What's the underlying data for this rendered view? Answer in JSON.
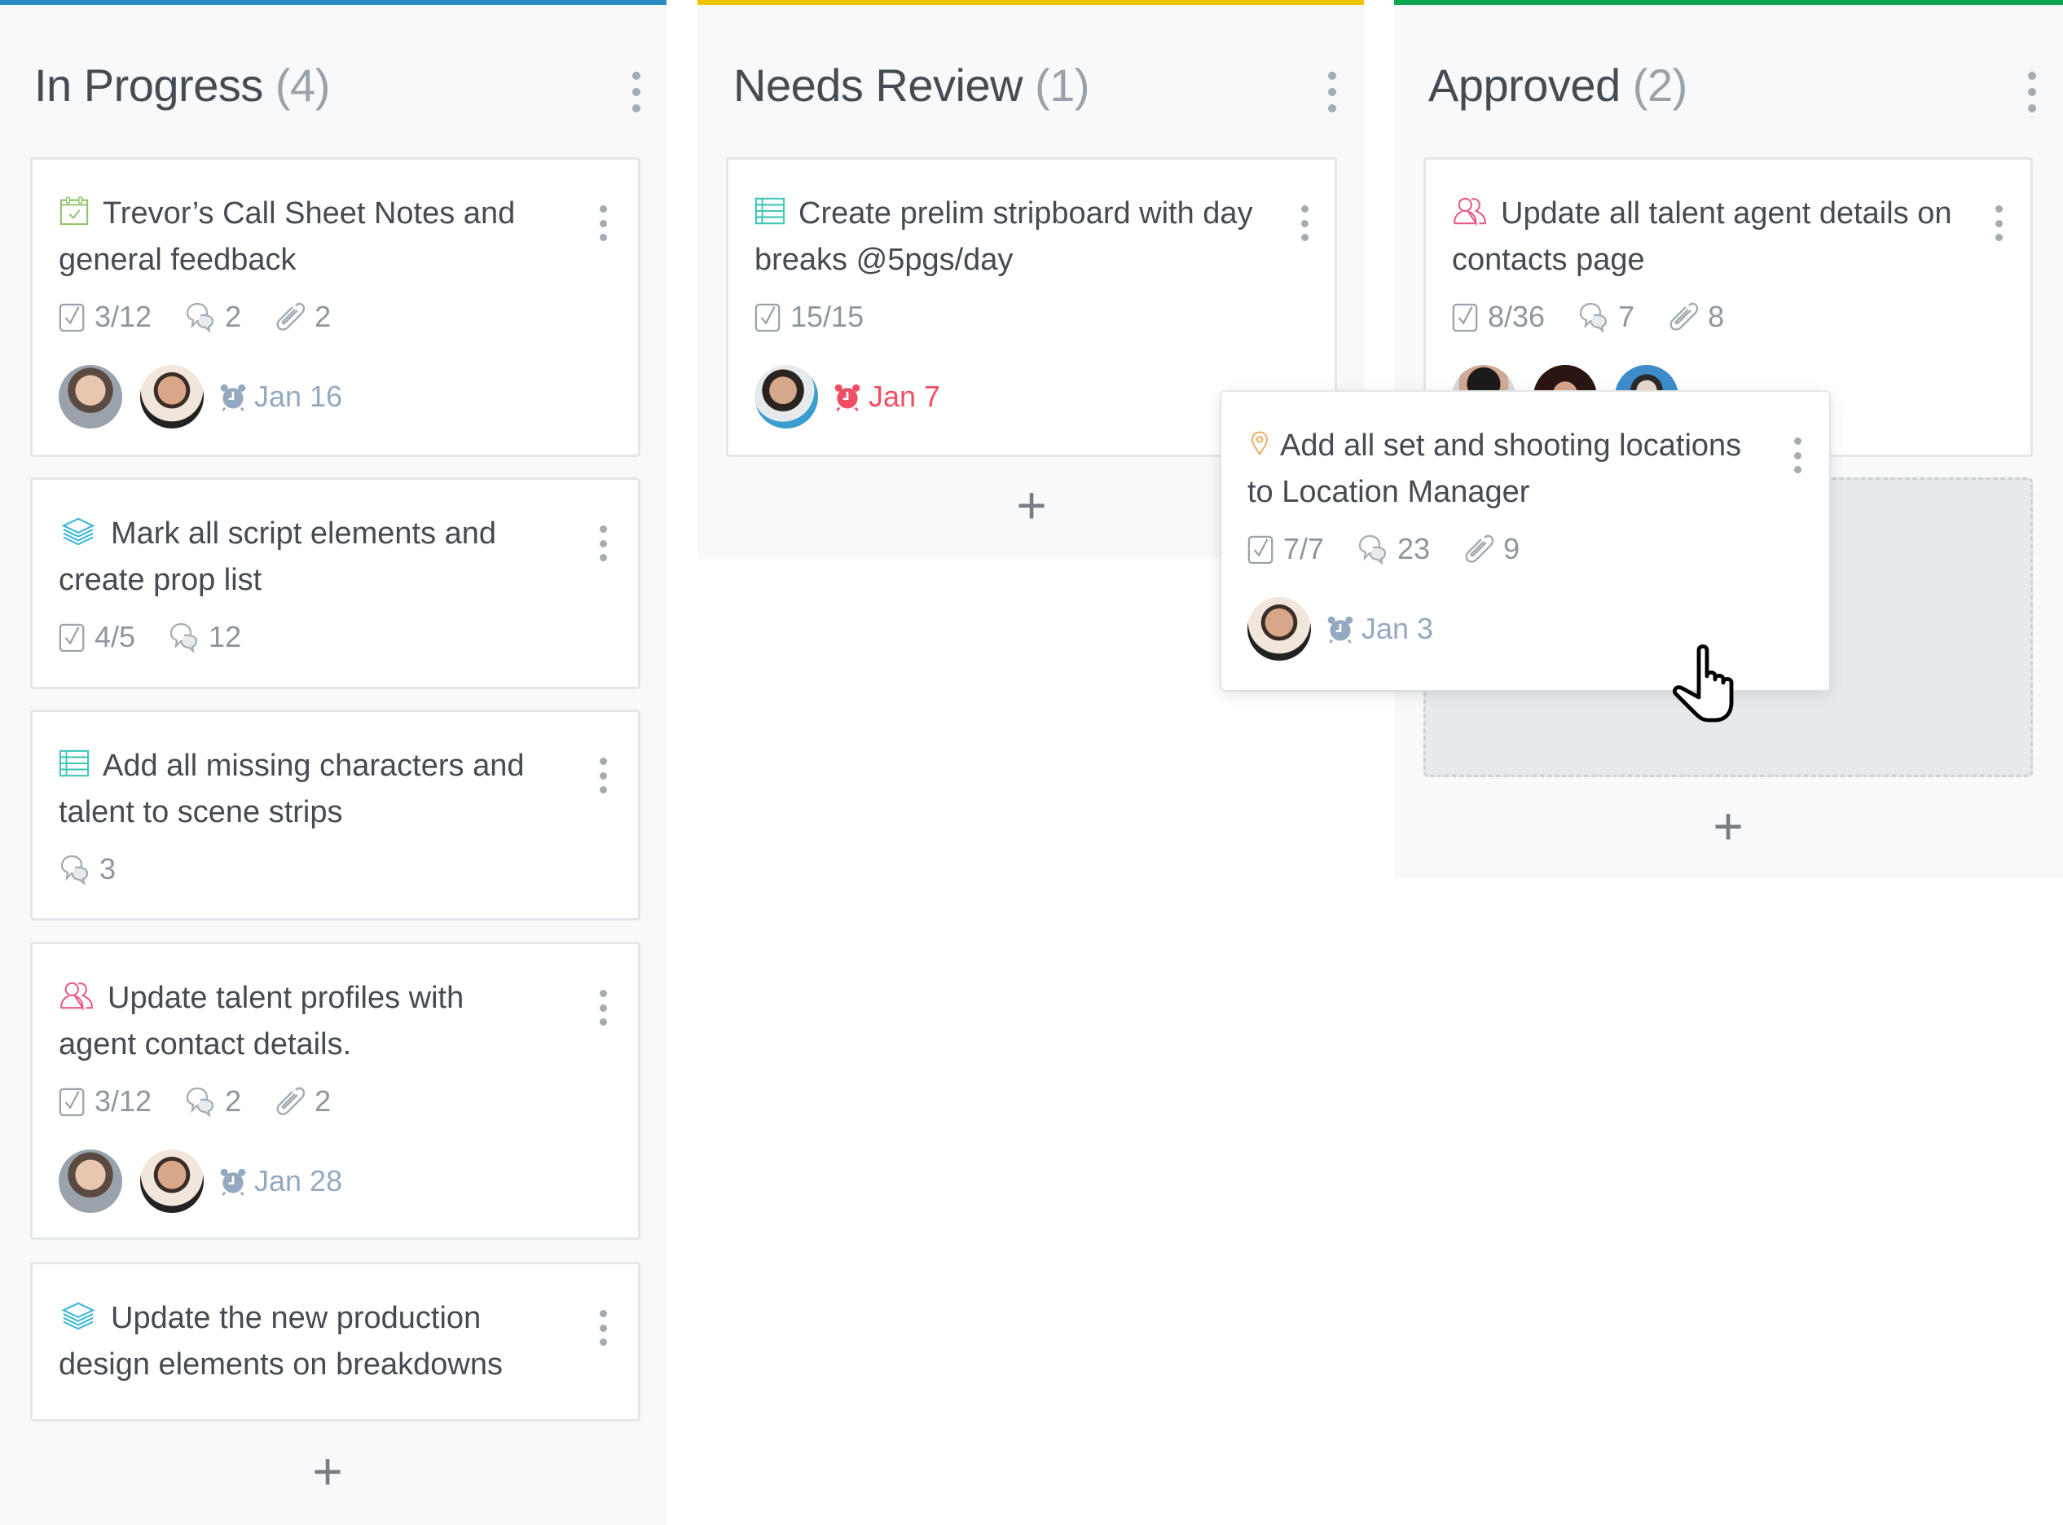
{
  "columns": [
    {
      "title": "In Progress",
      "count": "(4)",
      "accent": "#2a8ac8",
      "add_label": "+",
      "cards": [
        {
          "icon": "calendar-check-icon",
          "icon_color": "#8cc26a",
          "title": "Trevor’s Call Sheet Notes and general feedback",
          "checklist": "3/12",
          "comments": "2",
          "attachments": "2",
          "avatars": [
            "avatar-person-1",
            "avatar-person-2"
          ],
          "due": "Jan 16",
          "overdue": false
        },
        {
          "icon": "layers-icon",
          "icon_color": "#3bb4dc",
          "title": "Mark all script elements and create prop list",
          "checklist": "4/5",
          "comments": "12"
        },
        {
          "icon": "stripboard-icon",
          "icon_color": "#3ec6b4",
          "title": "Add all missing characters and talent to scene strips",
          "comments": "3"
        },
        {
          "icon": "contacts-icon",
          "icon_color": "#ea5a8c",
          "title": "Update talent profiles with agent contact details.",
          "checklist": "3/12",
          "comments": "2",
          "attachments": "2",
          "avatars": [
            "avatar-person-1",
            "avatar-person-2"
          ],
          "due": "Jan 28",
          "overdue": false
        },
        {
          "icon": "layers-icon",
          "icon_color": "#3bb4dc",
          "title": "Update the new production design elements on breakdowns"
        }
      ]
    },
    {
      "title": "Needs Review",
      "count": "(1)",
      "accent": "#f5c400",
      "add_label": "+",
      "cards": [
        {
          "icon": "stripboard-icon",
          "icon_color": "#3ec6b4",
          "title": "Create prelim stripboard with day breaks @5pgs/day",
          "checklist": "15/15",
          "avatars": [
            "avatar-person-3"
          ],
          "due": "Jan 7",
          "overdue": true
        }
      ]
    },
    {
      "title": "Approved",
      "count": "(2)",
      "accent": "#0aa64e",
      "add_label": "+",
      "cards": [
        {
          "icon": "contacts-icon",
          "icon_color": "#ea5a8c",
          "title": "Update all talent agent details on contacts page",
          "checklist": "8/36",
          "comments": "7",
          "attachments": "8",
          "avatars": [
            "avatar-person-4",
            "avatar-person-5",
            "avatar-person-6"
          ]
        }
      ]
    }
  ],
  "dragging_card": {
    "icon": "location-pin-icon",
    "icon_color": "#f0a050",
    "title": "Add all set and shooting locations to Location Manager",
    "checklist": "7/7",
    "comments": "23",
    "attachments": "9",
    "avatars": [
      "avatar-person-2"
    ],
    "due": "Jan 3",
    "overdue": false
  },
  "colors": {
    "due_normal": "#94a9bf",
    "due_overdue": "#ef4f64",
    "drop_zone": "#e7eaec"
  }
}
